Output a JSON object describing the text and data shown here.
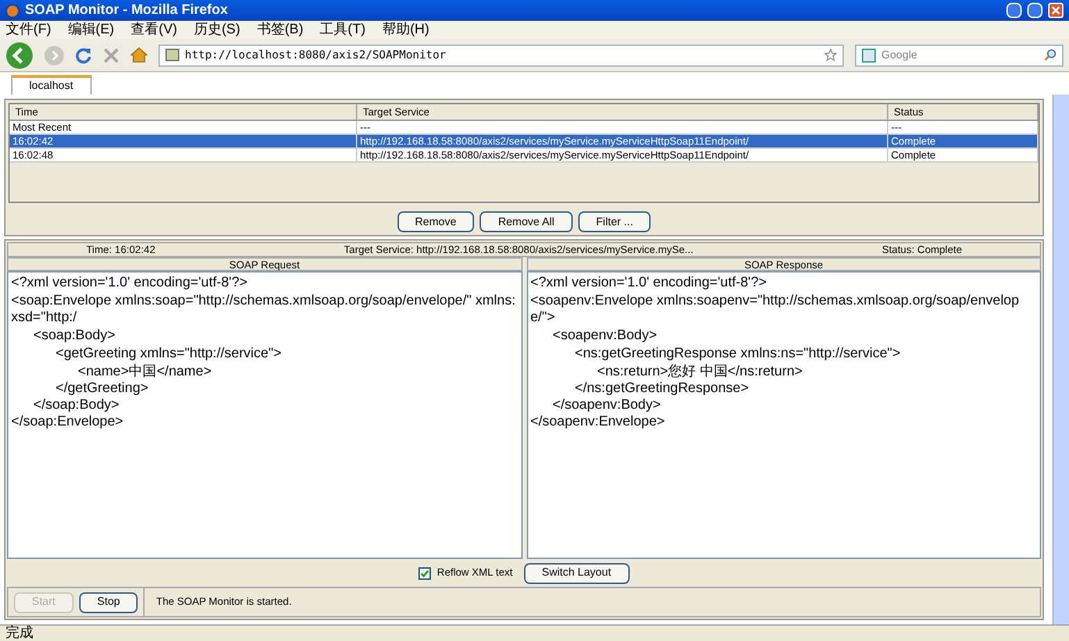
{
  "window": {
    "title": "SOAP Monitor - Mozilla Firefox"
  },
  "menu": [
    "文件(F)",
    "编辑(E)",
    "查看(V)",
    "历史(S)",
    "书签(B)",
    "工具(T)",
    "帮助(H)"
  ],
  "address": {
    "value": "http://localhost:8080/axis2/SOAPMonitor"
  },
  "search": {
    "placeholder": "Google"
  },
  "tabs": [
    {
      "label": "localhost",
      "selected": true
    }
  ],
  "table": {
    "columns": [
      "Time",
      "Target Service",
      "Status"
    ],
    "rows": [
      {
        "cells": [
          "Most Recent",
          "---",
          "---"
        ],
        "selected": false
      },
      {
        "cells": [
          "16:02:42",
          "http://192.168.18.58:8080/axis2/services/myService.myServiceHttpSoap11Endpoint/",
          "Complete"
        ],
        "selected": true
      },
      {
        "cells": [
          "16:02:48",
          "http://192.168.18.58:8080/axis2/services/myService.myServiceHttpSoap11Endpoint/",
          "Complete"
        ],
        "selected": false
      }
    ]
  },
  "table_buttons": [
    "Remove",
    "Remove All",
    "Filter ..."
  ],
  "info": [
    "Time: 16:02:42",
    "Target Service: http://192.168.18.58:8080/axis2/services/myService.mySe...",
    "Status: Complete"
  ],
  "panes": [
    {
      "title": "SOAP Request",
      "lines": [
        {
          "open": "<?xml version='1.0' encoding='utf-8'?>"
        },
        {
          "open": "<soap:Envelope xmlns:soap=\"http://schemas.xmlsoap.org/soap/envelope/\" xmlns:xsd=\"http:/",
          "close": "</soap:Envelope>",
          "children": [
            {
              "open": "<soap:Body>",
              "close": "</soap:Body>",
              "children": [
                {
                  "open": "<getGreeting xmlns=\"http://service\">",
                  "close": "</getGreeting>",
                  "children": [
                    {
                      "open": "<name>中国</name>"
                    }
                  ]
                }
              ]
            }
          ]
        }
      ]
    },
    {
      "title": "SOAP Response",
      "lines": [
        {
          "open": "<?xml version='1.0' encoding='utf-8'?>"
        },
        {
          "open": "<soapenv:Envelope xmlns:soapenv=\"http://schemas.xmlsoap.org/soap/envelope/\">",
          "close": "</soapenv:Envelope>",
          "children": [
            {
              "open": "<soapenv:Body>",
              "close": "</soapenv:Body>",
              "children": [
                {
                  "open": "<ns:getGreetingResponse xmlns:ns=\"http://service\">",
                  "close": "</ns:getGreetingResponse>",
                  "children": [
                    {
                      "open": "<ns:return>您好 中国</ns:return>"
                    }
                  ]
                }
              ]
            }
          ]
        }
      ]
    }
  ],
  "reflow": {
    "label": "Reflow XML text",
    "checked": true
  },
  "switch_button": "Switch Layout",
  "controls": [
    {
      "label": "Start",
      "disabled": true
    },
    {
      "label": "Stop",
      "disabled": false
    }
  ],
  "message": "The SOAP Monitor is started.",
  "status_bar": "完成"
}
